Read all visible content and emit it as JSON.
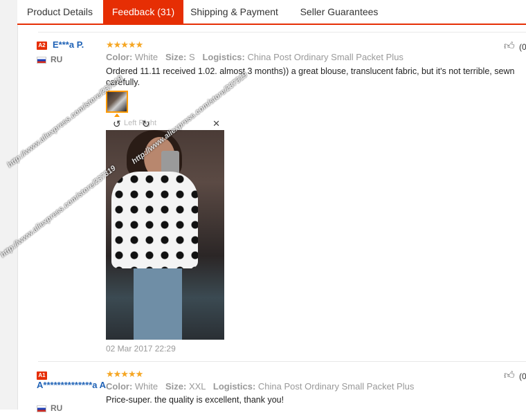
{
  "tabs": [
    {
      "label": "Product Details"
    },
    {
      "label": "Feedback (31)"
    },
    {
      "label": "Shipping & Payment"
    },
    {
      "label": "Seller Guarantees"
    }
  ],
  "reviews": [
    {
      "level": "A2",
      "user": "E***a P.",
      "country": "RU",
      "stars": "★★★★★",
      "color_label": "Color:",
      "color": "White",
      "size_label": "Size:",
      "size": "S",
      "logistics_label": "Logistics:",
      "logistics": "China Post Ordinary Small Packet Plus",
      "text": "Ordered 11.11 received 1.02. almost 3 months)) a great blouse, translucent fabric, but it's not terrible, sewn carefully.",
      "viewer_label": "Left    Right",
      "watermark": "http://www.aliexpress.com/store/237319",
      "date": "02 Mar 2017 22:29",
      "likes": "(0"
    },
    {
      "level": "A1",
      "user": "A**************a A.",
      "country": "RU",
      "stars": "★★★★★",
      "color_label": "Color:",
      "color": "White",
      "size_label": "Size:",
      "size": "XXL",
      "logistics_label": "Logistics:",
      "logistics": "China Post Ordinary Small Packet Plus",
      "text": "Price-super. the quality is excellent, thank you!",
      "likes": "(0"
    }
  ],
  "icons": {
    "like": "thumbs-up-icon",
    "close": "close-icon",
    "rotate_left": "rotate-left-icon",
    "rotate_right": "rotate-right-icon"
  },
  "colors": {
    "accent": "#e62e04",
    "username": "#1f62b6",
    "stars": "#f5a623"
  }
}
